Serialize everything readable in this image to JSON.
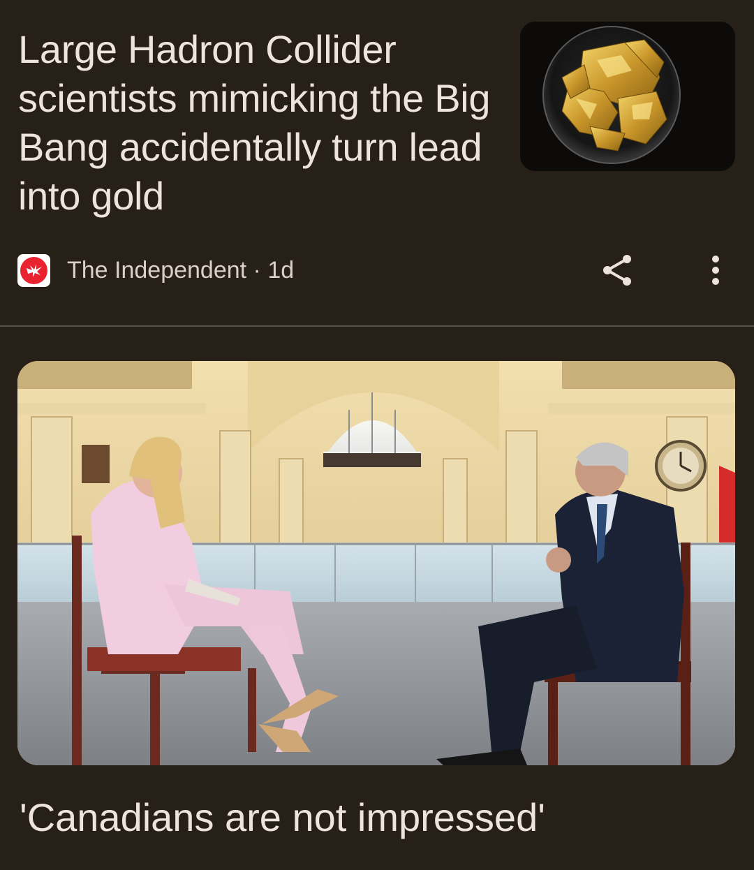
{
  "article1": {
    "headline": "Large Hadron Collider scientists mimicking the Big Bang accidentally turn lead into gold",
    "source": "The Independent",
    "separator": " · ",
    "age": "1d",
    "thumbnail_icon": "gold-flakes-dish-image",
    "source_logo_icon": "independent-eagle-logo",
    "share_icon": "share-icon",
    "more_icon": "more-vertical-icon"
  },
  "article2": {
    "headline": "'Canadians are not impressed'",
    "image_icon": "interview-photo"
  },
  "colors": {
    "background": "#272019",
    "text": "#ede5dd",
    "brand_red": "#e8222e",
    "divider": "#5a534b"
  }
}
